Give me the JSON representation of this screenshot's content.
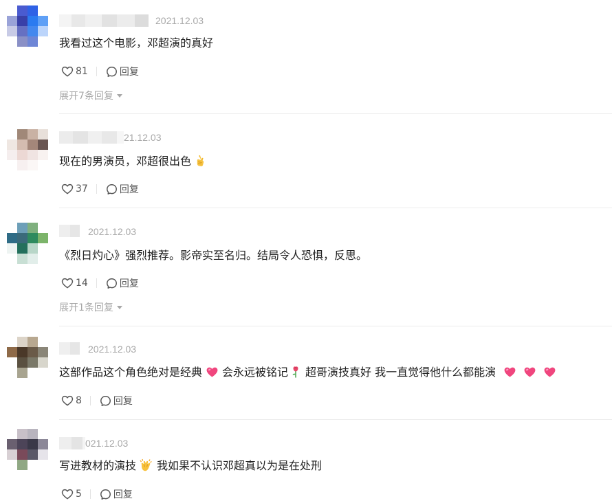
{
  "comments": [
    {
      "date": "2021.12.03",
      "text": "我看过这个电影，邓超演的真好",
      "likes": "81",
      "reply_label": "回复",
      "expand_label": "展开7条回复"
    },
    {
      "date": "21.12.03",
      "text": "现在的男演员，邓超很出色",
      "emoji": "crossed-fingers-emoji",
      "likes": "37",
      "reply_label": "回复"
    },
    {
      "date": "2021.12.03",
      "text": "《烈日灼心》强烈推荐。影帝实至名归。结局令人恐惧，反思。",
      "likes": "14",
      "reply_label": "回复",
      "expand_label": "展开1条回复"
    },
    {
      "date": "2021.12.03",
      "text_parts": [
        "这部作品这个角色绝对是经典",
        "会永远被铭记",
        "超哥演技真好 我一直觉得他什么都能演"
      ],
      "likes": "8",
      "reply_label": "回复"
    },
    {
      "date": "021.12.03",
      "text_parts": [
        "写进教材的演技",
        "我如果不认识邓超真以为是在处刑"
      ],
      "likes": "5",
      "reply_label": "回复"
    }
  ],
  "colors": {
    "heart_emoji": "#f0467e",
    "muted_text": "#a8a8a8",
    "divider": "#ececec"
  }
}
